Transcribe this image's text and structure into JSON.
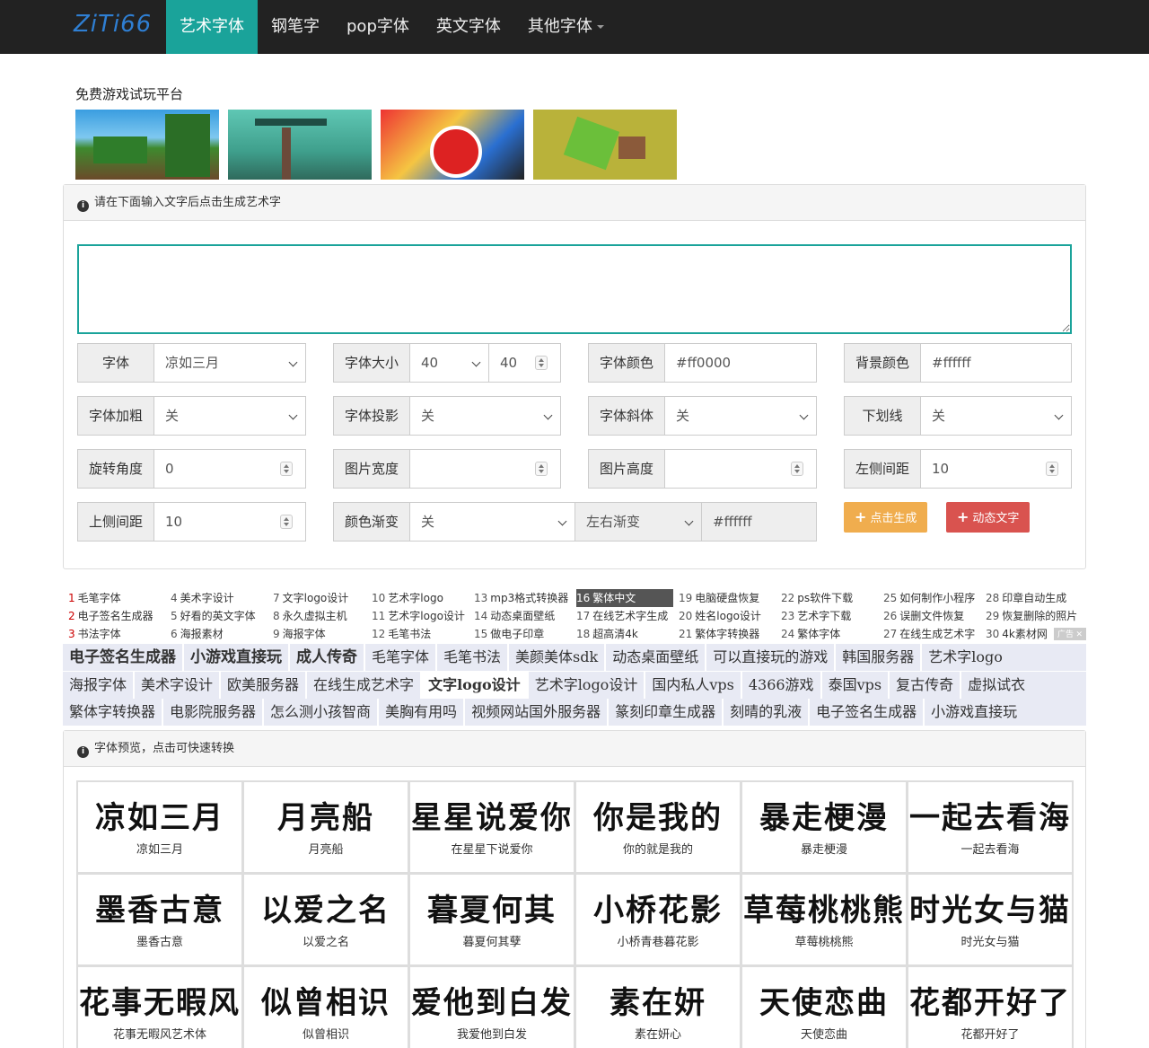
{
  "brand": "ZiTi66",
  "nav": [
    "艺术字体",
    "钢笔字",
    "pop字体",
    "英文字体",
    "其他字体"
  ],
  "ad_title": "免费游戏试玩平台",
  "panel1": {
    "heading": "请在下面输入文字后点击生成艺术字",
    "text_value": "",
    "fields": {
      "font": {
        "label": "字体",
        "value": "凉如三月"
      },
      "size": {
        "label": "字体大小",
        "value": "40",
        "value2": "40"
      },
      "color": {
        "label": "字体颜色",
        "value": "#ff0000"
      },
      "bg": {
        "label": "背景颜色",
        "value": "#ffffff"
      },
      "bold": {
        "label": "字体加粗",
        "value": "关"
      },
      "shadow": {
        "label": "字体投影",
        "value": "关"
      },
      "italic": {
        "label": "字体斜体",
        "value": "关"
      },
      "underline": {
        "label": "下划线",
        "value": "关"
      },
      "rotate": {
        "label": "旋转角度",
        "value": "0"
      },
      "width": {
        "label": "图片宽度",
        "value": ""
      },
      "height": {
        "label": "图片高度",
        "value": ""
      },
      "left": {
        "label": "左侧间距",
        "value": "10"
      },
      "top": {
        "label": "上侧间距",
        "value": "10"
      },
      "gradient": {
        "label": "颜色渐变",
        "value": "关",
        "direction": "左右渐变",
        "color": "#ffffff"
      }
    },
    "buttons": {
      "generate": "点击生成",
      "dynamic": "动态文字"
    }
  },
  "link_columns": [
    [
      [
        "1",
        "毛笔字体"
      ],
      [
        "2",
        "电子签名生成器"
      ],
      [
        "3",
        "书法字体"
      ]
    ],
    [
      [
        "4",
        "美术字设计"
      ],
      [
        "5",
        "好看的英文字体"
      ],
      [
        "6",
        "海报素材"
      ]
    ],
    [
      [
        "7",
        "文字logo设计"
      ],
      [
        "8",
        "永久虚拟主机"
      ],
      [
        "9",
        "海报字体"
      ]
    ],
    [
      [
        "10",
        "艺术字logo"
      ],
      [
        "11",
        "艺术字logo设计"
      ],
      [
        "12",
        "毛笔书法"
      ]
    ],
    [
      [
        "13",
        "mp3格式转换器"
      ],
      [
        "14",
        "动态桌面壁纸"
      ],
      [
        "15",
        "做电子印章"
      ]
    ],
    [
      [
        "16",
        "繁体中文"
      ],
      [
        "17",
        "在线艺术字生成"
      ],
      [
        "18",
        "超高清4k"
      ]
    ],
    [
      [
        "19",
        "电脑硬盘恢复"
      ],
      [
        "20",
        "姓名logo设计"
      ],
      [
        "21",
        "繁体字转换器"
      ]
    ],
    [
      [
        "22",
        "ps软件下载"
      ],
      [
        "23",
        "艺术字下载"
      ],
      [
        "24",
        "繁体字体"
      ]
    ],
    [
      [
        "25",
        "如何制作小程序"
      ],
      [
        "26",
        "误删文件恢复"
      ],
      [
        "27",
        "在线生成艺术字"
      ]
    ],
    [
      [
        "28",
        "印章自动生成"
      ],
      [
        "29",
        "恢复删除的照片"
      ],
      [
        "30",
        "4k素材网"
      ]
    ]
  ],
  "tag_rows": [
    [
      "电子签名生成器",
      "小游戏直接玩",
      "成人传奇",
      "毛笔字体",
      "毛笔书法",
      "美颜美体sdk",
      "动态桌面壁纸",
      "可以直接玩的游戏",
      "韩国服务器",
      "艺术字logo"
    ],
    [
      "海报字体",
      "美术字设计",
      "欧美服务器",
      "在线生成艺术字",
      "文字logo设计",
      "艺术字logo设计",
      "国内私人vps",
      "4366游戏",
      "泰国vps",
      "复古传奇",
      "虚拟试衣"
    ],
    [
      "繁体字转换器",
      "电影院服务器",
      "怎么测小孩智商",
      "美胸有用吗",
      "视频网站国外服务器",
      "篆刻印章生成器",
      "刻晴的乳液",
      "电子签名生成器",
      "小游戏直接玩"
    ]
  ],
  "ad_close": "广告 ✕",
  "panel2": {
    "heading": "字体预览，点击可快速转换",
    "fonts": [
      {
        "sample": "凉如三月",
        "name": "凉如三月"
      },
      {
        "sample": "月亮船",
        "name": "月亮船"
      },
      {
        "sample": "星星说爱你",
        "name": "在星星下说爱你"
      },
      {
        "sample": "你是我的",
        "name": "你的就是我的"
      },
      {
        "sample": "暴走梗漫",
        "name": "暴走梗漫"
      },
      {
        "sample": "一起去看海",
        "name": "一起去看海"
      },
      {
        "sample": "墨香古意",
        "name": "墨香古意"
      },
      {
        "sample": "以爱之名",
        "name": "以爱之名"
      },
      {
        "sample": "暮夏何其",
        "name": "暮夏何其孽"
      },
      {
        "sample": "小桥花影",
        "name": "小桥青巷暮花影"
      },
      {
        "sample": "草莓桃桃熊",
        "name": "草莓桃桃熊"
      },
      {
        "sample": "时光女与猫",
        "name": "时光女与猫"
      },
      {
        "sample": "花事无暇风",
        "name": "花事无暇风艺术体"
      },
      {
        "sample": "似曾相识",
        "name": "似曾相识"
      },
      {
        "sample": "爱他到白发",
        "name": "我爱他到白发"
      },
      {
        "sample": "素在妍",
        "name": "素在妍心"
      },
      {
        "sample": "天使恋曲",
        "name": "天使恋曲"
      },
      {
        "sample": "花都开好了",
        "name": "花都开好了"
      }
    ]
  }
}
